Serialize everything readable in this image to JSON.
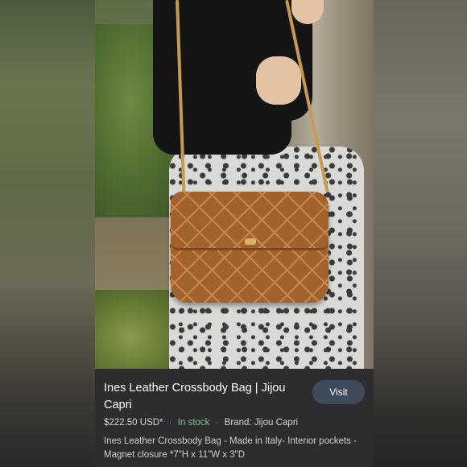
{
  "image": {
    "alt": "product-photo"
  },
  "product": {
    "title": "Ines Leather Crossbody Bag | Jijou Capri",
    "price": "$222.50 USD*",
    "separator": "·",
    "stock": "In stock",
    "brand": "Brand: Jijou Capri",
    "description": "Ines Leather Crossbody Bag - Made in Italy- Interior pockets - Magnet closure *7\"H x 11\"W x 3\"D"
  },
  "actions": {
    "visit_label": "Visit"
  },
  "colors": {
    "panel_bg": "#2d2d2f",
    "visit_bg": "#3f4a5a",
    "stock": "#7bc68a"
  }
}
